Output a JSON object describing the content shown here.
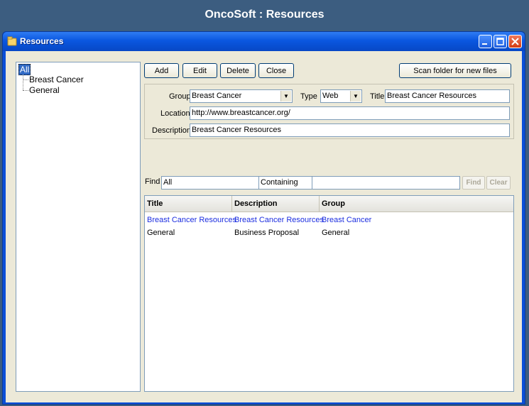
{
  "app_header": {
    "title": "OncoSoft : Resources"
  },
  "window": {
    "title": "Resources"
  },
  "tree": {
    "root": "All",
    "items": [
      "Breast Cancer",
      "General"
    ]
  },
  "toolbar": {
    "add": "Add",
    "edit": "Edit",
    "delete": "Delete",
    "close": "Close",
    "scan": "Scan folder for new files"
  },
  "form": {
    "group_label": "Group",
    "group_value": "Breast Cancer",
    "type_label": "Type",
    "type_value": "Web",
    "title_label": "Title",
    "title_value": "Breast Cancer Resources",
    "location_label": "Location",
    "location_value": "http://www.breastcancer.org/",
    "description_label": "Description",
    "description_value": "Breast Cancer Resources"
  },
  "find": {
    "label": "Find",
    "field": "All",
    "mode": "Containing",
    "value": "",
    "find_button": "Find",
    "clear_button": "Clear"
  },
  "table": {
    "columns": [
      "Title",
      "Description",
      "Group"
    ],
    "rows": [
      [
        "Breast Cancer Resources",
        "Breast Cancer Resources",
        "Breast Cancer"
      ],
      [
        "General",
        "Business Proposal",
        "General"
      ]
    ]
  },
  "colors": {
    "link": "#1c2ee0",
    "titlebar": "#0a57e0",
    "header_bg": "#3c5d80"
  }
}
